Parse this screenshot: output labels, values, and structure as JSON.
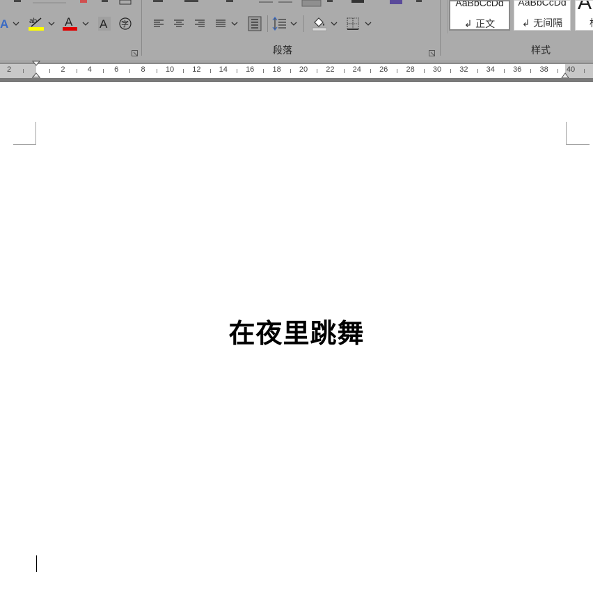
{
  "ribbon": {
    "font_group": {
      "highlight_color": "#ffff00",
      "font_color": "#e00000",
      "text_effects_glyph": "A",
      "char_shading_glyph": "A",
      "phonetic_glyph": "字",
      "highlight_glyph": "ab"
    },
    "paragraph_group": {
      "label": "段落"
    },
    "styles_group": {
      "label": "样式",
      "items": [
        {
          "sample": "AaBbCcDd",
          "name": "↲ 正文",
          "selected": true
        },
        {
          "sample": "AaBbCcDd",
          "name": "↲ 无间隔",
          "selected": false
        },
        {
          "sample": "A",
          "name": "标",
          "selected": false
        }
      ]
    }
  },
  "ruler": {
    "labels": [
      "2",
      "2",
      "4",
      "6",
      "8",
      "10",
      "12",
      "14",
      "16",
      "18",
      "20",
      "22",
      "24",
      "26",
      "28",
      "30",
      "32",
      "34",
      "36",
      "38",
      "40"
    ]
  },
  "document": {
    "title": "在夜里跳舞"
  }
}
